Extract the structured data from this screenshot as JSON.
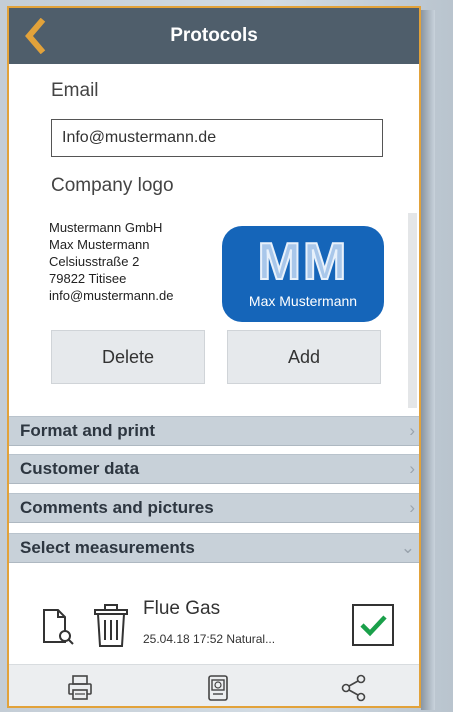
{
  "header": {
    "title": "Protocols",
    "back_icon": "chevron-left-icon"
  },
  "email": {
    "label": "Email",
    "value": "Info@mustermann.de"
  },
  "logo_section": {
    "label": "Company logo",
    "address_lines": [
      "Mustermann GmbH",
      "Max Mustermann",
      "Celsiusstraße 2",
      "79822 Titisee",
      "info@mustermann.de"
    ],
    "logo_initials": "MM",
    "logo_name": "Max Mustermann",
    "delete_label": "Delete",
    "add_label": "Add"
  },
  "sections": [
    {
      "label": "Format and print",
      "state": "collapsed"
    },
    {
      "label": "Customer data",
      "state": "collapsed"
    },
    {
      "label": "Comments and pictures",
      "state": "collapsed"
    },
    {
      "label": "Select measurements",
      "state": "expanded"
    }
  ],
  "measurement": {
    "name": "Flue Gas",
    "meta": "25.04.18  17:52  Natural...",
    "checked": true,
    "icons": [
      "document-search-icon",
      "trash-icon"
    ]
  },
  "footer": {
    "icons": [
      "printer-icon",
      "device-icon",
      "share-icon"
    ]
  },
  "colors": {
    "header": "#4f5e6b",
    "accent": "#e2a23a",
    "logo": "#1565b9",
    "section": "#c8d1d9",
    "check": "#1aa04a"
  }
}
